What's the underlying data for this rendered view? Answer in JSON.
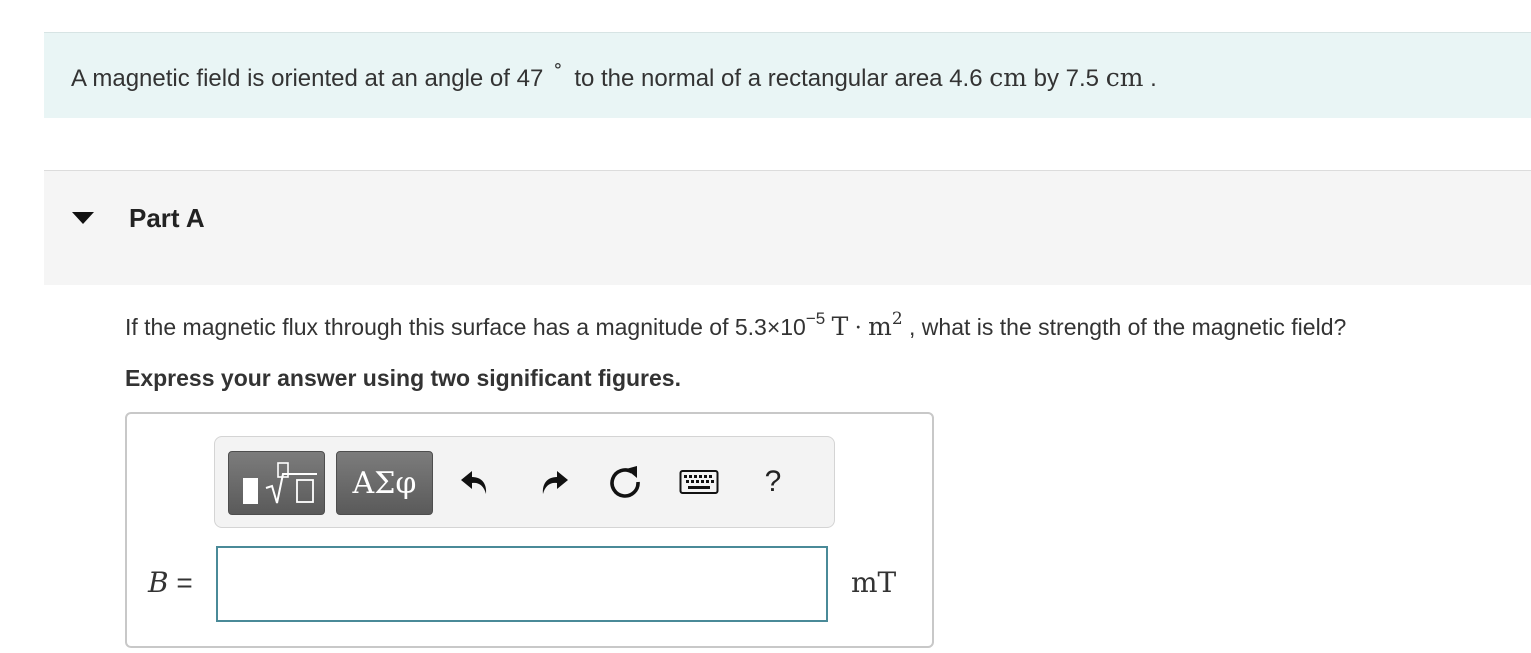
{
  "intro": {
    "text_part1": "A magnetic field is oriented at an angle of 47",
    "degree_symbol": "°",
    "text_part2": "to the normal of a rectangular area 4.6",
    "unit_cm_1": "cm",
    "text_part3": "by 7.5",
    "unit_cm_2": "cm",
    "text_end": "."
  },
  "part": {
    "title": "Part A"
  },
  "question": {
    "text_part1": "If the magnetic flux through this surface has a magnitude of 5.3×10",
    "exponent": "−5",
    "unit_T": "T",
    "dot": "·",
    "unit_m": "m",
    "unit_m_exponent": "2",
    "text_part2": ", what is the strength of the magnetic field?"
  },
  "instruction": "Express your answer using two significant figures.",
  "toolbar": {
    "templates_icon": "templates-icon",
    "symbols_label": "ΑΣφ",
    "undo_icon": "undo-icon",
    "redo_icon": "redo-icon",
    "reset_icon": "reset-icon",
    "keyboard_icon": "keyboard-icon",
    "help_label": "?"
  },
  "answer": {
    "variable": "B",
    "equals": "=",
    "value": "",
    "units": "mT"
  }
}
